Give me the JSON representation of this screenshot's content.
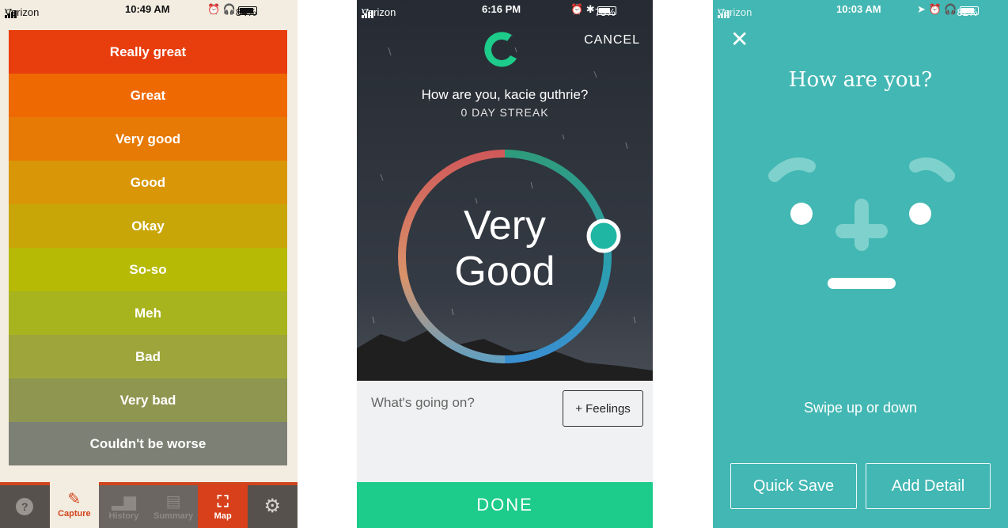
{
  "screen1": {
    "status": {
      "carrier": "Verizon",
      "time": "10:49 AM",
      "battery": "84%"
    },
    "moods": [
      {
        "label": "Really great",
        "color": "#e83d0c"
      },
      {
        "label": "Great",
        "color": "#ef6903"
      },
      {
        "label": "Very good",
        "color": "#e77a04"
      },
      {
        "label": "Good",
        "color": "#d99606"
      },
      {
        "label": "Okay",
        "color": "#c9a607"
      },
      {
        "label": "So-so",
        "color": "#b6ba04"
      },
      {
        "label": "Meh",
        "color": "#a8b41e"
      },
      {
        "label": "Bad",
        "color": "#9ea53b"
      },
      {
        "label": "Very bad",
        "color": "#8f9650"
      },
      {
        "label": "Couldn't be worse",
        "color": "#7d8075"
      }
    ],
    "tabs": {
      "help": "?",
      "capture": "Capture",
      "history": "History",
      "summary": "Summary",
      "map": "Map",
      "settings": "⚙"
    }
  },
  "screen2": {
    "status": {
      "carrier": "Verizon",
      "time": "6:16 PM",
      "battery": "73%"
    },
    "cancel": "CANCEL",
    "question": "How are you, kacie guthrie?",
    "streak": "0 DAY STREAK",
    "mood_line1": "Very",
    "mood_line2": "Good",
    "input_placeholder": "What's going on?",
    "feelings_button": "+ Feelings",
    "done_button": "DONE"
  },
  "screen3": {
    "status": {
      "carrier": "Verizon",
      "time": "10:03 AM",
      "battery": "82%"
    },
    "close": "✕",
    "question": "How are you?",
    "hint": "Swipe up or down",
    "quick_save": "Quick Save",
    "add_detail": "Add Detail"
  }
}
